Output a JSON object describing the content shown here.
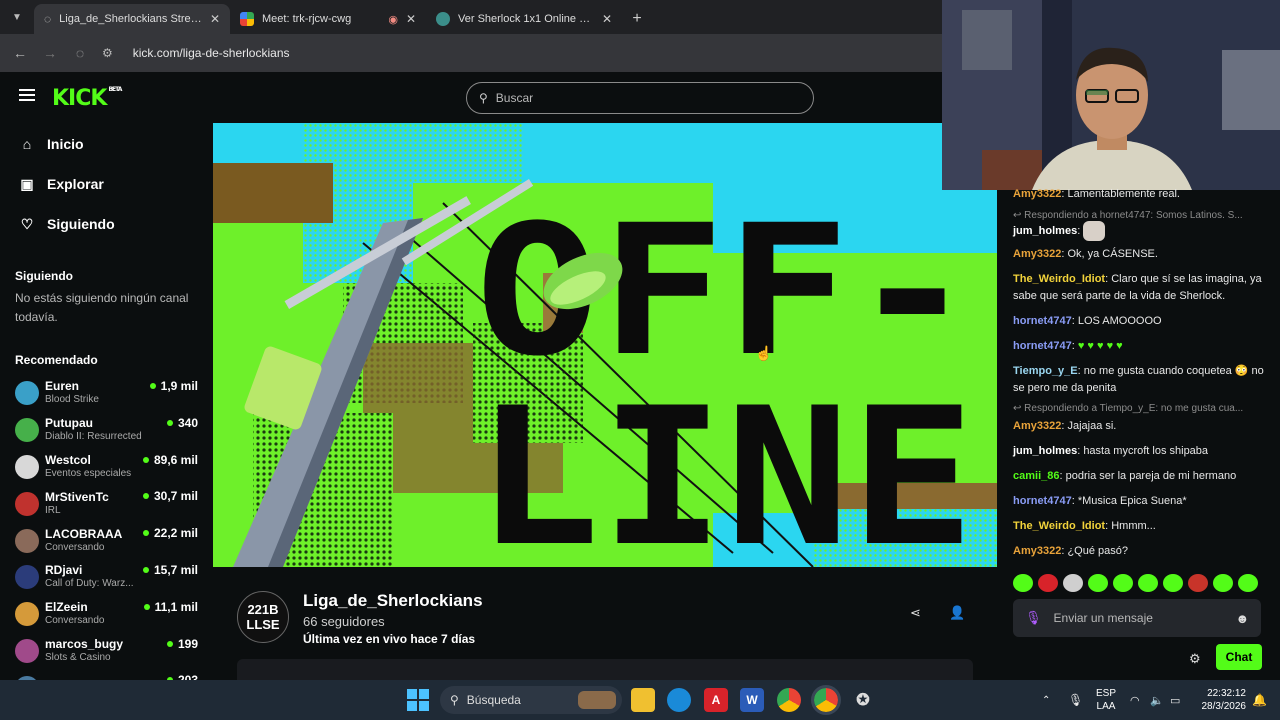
{
  "browser": {
    "tabs": [
      {
        "title": "Liga_de_Sherlockians Stream - ‘",
        "active": true
      },
      {
        "title": "Meet: trk-rjcw-cwg",
        "active": false
      },
      {
        "title": "Ver Sherlock 1x1 Online Gratis",
        "active": false
      }
    ],
    "url": "kick.com/liga-de-sherlockians"
  },
  "header": {
    "logo": "KICK",
    "logo_badge": "BETA",
    "search_placeholder": "Buscar"
  },
  "sidebar": {
    "nav": [
      {
        "label": "Inicio",
        "icon": "home-icon"
      },
      {
        "label": "Explorar",
        "icon": "compass-icon"
      },
      {
        "label": "Siguiendo",
        "icon": "heart-icon"
      }
    ],
    "following_title": "Siguiendo",
    "following_empty": "No estás siguiendo ningún canal todavía.",
    "recommended_title": "Recomendado",
    "recommended": [
      {
        "name": "Euren",
        "category": "Blood Strike",
        "viewers": "1,9 mil",
        "color": "#3aa0c8"
      },
      {
        "name": "Putupau",
        "category": "Diablo II: Resurrected",
        "viewers": "340",
        "color": "#46b04a"
      },
      {
        "name": "Westcol",
        "category": "Eventos especiales",
        "viewers": "89,6 mil",
        "color": "#d8d8d8"
      },
      {
        "name": "MrStivenTc",
        "category": "IRL",
        "viewers": "30,7 mil",
        "color": "#c0322e"
      },
      {
        "name": "LACOBRAAA",
        "category": "Conversando",
        "viewers": "22,2 mil",
        "color": "#8a6a5a"
      },
      {
        "name": "RDjavi",
        "category": "Call of Duty: Warz...",
        "viewers": "15,7 mil",
        "color": "#2b3c7a"
      },
      {
        "name": "ElZeein",
        "category": "Conversando",
        "viewers": "11,1 mil",
        "color": "#d59a3a"
      },
      {
        "name": "marcos_bugy",
        "category": "Slots & Casino",
        "viewers": "199",
        "color": "#a04a8a"
      },
      {
        "name": "Xdluio",
        "category": "",
        "viewers": "203",
        "color": "#4a7aa0"
      }
    ]
  },
  "video": {
    "offline_line1": "OFF-",
    "offline_line2": "LINE"
  },
  "channel": {
    "avatar_line1": "221B",
    "avatar_line2": "LLSE",
    "name": "Liga_de_Sherlockians",
    "followers": "66 seguidores",
    "last_live": "Última vez en vivo hace 7 días"
  },
  "chat": {
    "messages": [
      {
        "user": "Amy3322",
        "color": "#e9a33a",
        "text": "Lamentablemente real."
      },
      {
        "reply": "Respondiendo a hornet4747: Somos Latinos. S..."
      },
      {
        "user": "jum_holmes",
        "color": "#ffffff",
        "text": "",
        "emote": true
      },
      {
        "user": "Amy3322",
        "color": "#e9a33a",
        "text": "Ok, ya CÁSENSE."
      },
      {
        "user": "The_Weirdo_Idiot",
        "color": "#f2d33b",
        "text": "Claro que sí se las imagina, ya sabe que será parte de la vida de Sherlock."
      },
      {
        "user": "hornet4747",
        "color": "#8a9cf5",
        "text": "LOS AMOOOOO"
      },
      {
        "user": "hornet4747",
        "color": "#8a9cf5",
        "text": "♥ ♥ ♥ ♥ ♥"
      },
      {
        "user": "Tiempo_y_E",
        "color": "#9ad6f0",
        "text": "no me gusta cuando coquetea 😳 no se pero me da penita"
      },
      {
        "reply": "Respondiendo a Tiempo_y_E: no me gusta cua..."
      },
      {
        "user": "Amy3322",
        "color": "#e9a33a",
        "text": "Jajajaa si."
      },
      {
        "user": "jum_holmes",
        "color": "#ffffff",
        "text": "hasta mycroft los shipaba"
      },
      {
        "user": "camii_86",
        "color": "#53fc18",
        "text": "podria ser la pareja de mi hermano"
      },
      {
        "user": "hornet4747",
        "color": "#8a9cf5",
        "text": "*Musica Epica Suena*"
      },
      {
        "user": "The_Weirdo_Idiot",
        "color": "#f2d33b",
        "text": "Hmmm..."
      },
      {
        "user": "Amy3322",
        "color": "#e9a33a",
        "text": "¿Qué pasó?"
      }
    ],
    "input_placeholder": "Enviar un mensaje",
    "send_label": "Chat"
  },
  "taskbar": {
    "search_label": "Búsqueda",
    "lang_line1": "ESP",
    "lang_line2": "LAA",
    "time": "22:32:12",
    "date": "28/3/2026"
  }
}
